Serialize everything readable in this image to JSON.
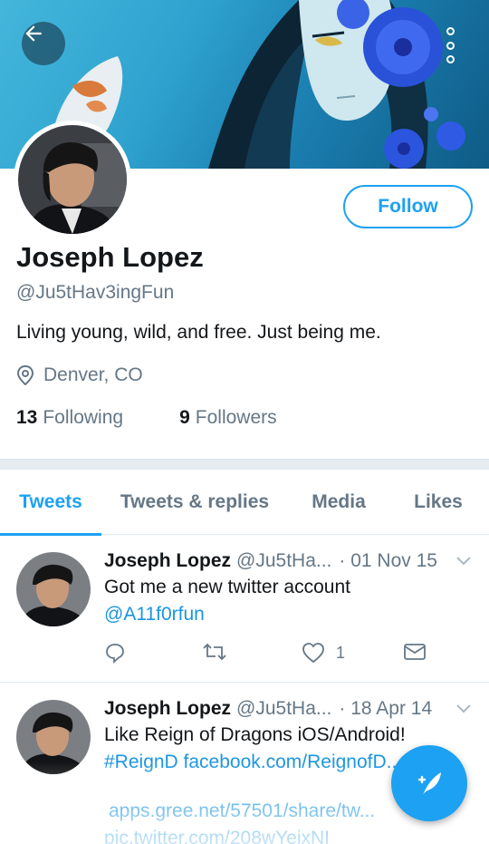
{
  "header": {
    "back_icon": "arrow-left-icon",
    "more_icon": "more-vertical-icon"
  },
  "profile": {
    "name": "Joseph Lopez",
    "handle": "@Ju5tHav3ingFun",
    "bio": "Living young, wild, and free. Just being me.",
    "location": "Denver, CO",
    "follow_label": "Follow",
    "following_count": "13",
    "following_label": "Following",
    "followers_count": "9",
    "followers_label": "Followers"
  },
  "tabs": [
    {
      "label": "Tweets",
      "active": true
    },
    {
      "label": "Tweets & replies",
      "active": false
    },
    {
      "label": "Media",
      "active": false
    },
    {
      "label": "Likes",
      "active": false
    }
  ],
  "tweets": [
    {
      "name": "Joseph Lopez",
      "handle": "@Ju5tHa...",
      "date": "· 01 Nov 15",
      "line1": "Got me a new twitter account",
      "line2": "@A11f0rfun",
      "likes": "1"
    },
    {
      "name": "Joseph Lopez",
      "handle": "@Ju5tHa...",
      "date": "· 18 Apr 14",
      "line1": "Like Reign of Dragons iOS/Android!",
      "line2": "#ReignD facebook.com/ReignofD...s",
      "line3": "apps.gree.net/57501/share/tw...",
      "line4": "pic.twitter.com/208wYeixNI"
    }
  ],
  "colors": {
    "accent": "#1da1f2",
    "link": "#1b95e0",
    "muted": "#657786",
    "text": "#14171a"
  },
  "fab_icon": "compose-tweet-icon"
}
